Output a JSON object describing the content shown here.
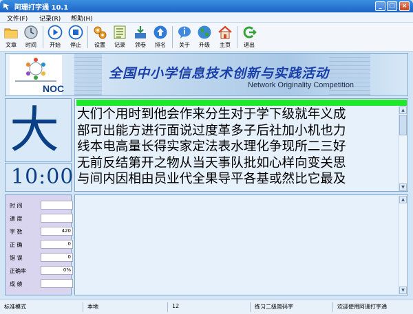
{
  "window": {
    "title": "阿珊打字通 10.1"
  },
  "menu": [
    "文件(F)",
    "记录(R)",
    "帮助(H)"
  ],
  "toolbar": [
    {
      "label": "文章",
      "icon": "folder-icon",
      "color": "#e9a524"
    },
    {
      "label": "时间",
      "icon": "clock-icon",
      "color": "#7a8a9c"
    },
    {
      "label": "开始",
      "icon": "play-icon",
      "color": "#1f68c9"
    },
    {
      "label": "停止",
      "icon": "stop-icon",
      "color": "#1f68c9"
    },
    {
      "label": "设置",
      "icon": "gears-icon",
      "color": "#d88a1f"
    },
    {
      "label": "记录",
      "icon": "records-list-icon",
      "color": "#6f8f2a"
    },
    {
      "label": "领卷",
      "icon": "download-icon",
      "color": "#2c8a4a"
    },
    {
      "label": "排名",
      "icon": "ranking-up-icon",
      "color": "#1f68c9"
    },
    {
      "label": "关于",
      "icon": "info-bubble-icon",
      "color": "#2f7bd9"
    },
    {
      "label": "升级",
      "icon": "globe-icon",
      "color": "#2c9a3a"
    },
    {
      "label": "主页",
      "icon": "home-icon",
      "color": "#d9452a"
    },
    {
      "label": "退出",
      "icon": "exit-icon",
      "color": "#36a23a"
    }
  ],
  "banner": {
    "logo": "NOC",
    "title": "全国中小学信息技术创新与实践活动",
    "subtitle": "Network Originality Competition"
  },
  "current_char": "大",
  "timer": "10:00",
  "text_lines": [
    "大们个用时到他会作来分生对于学下级就年义成",
    "部可出能方进行面说过度革多子后社加小机也力",
    "线本电高量长得实家定法表水理化争现所二三好",
    "无前反结第开之物从当天事队批如心样向变关思",
    "与间内因相由员业代全果导平各基或然比它最及"
  ],
  "stats": [
    {
      "key": "时 间",
      "value": ""
    },
    {
      "key": "速 度",
      "value": ""
    },
    {
      "key": "字 数",
      "value": "420"
    },
    {
      "key": "正 确",
      "value": "0"
    },
    {
      "key": "错 误",
      "value": "0"
    },
    {
      "key": "正确率",
      "value": "0%"
    },
    {
      "key": "成 绩",
      "value": ""
    }
  ],
  "status": {
    "mode": "标准模式",
    "source": "本地",
    "count": "12",
    "lesson": "练习二级简码字",
    "welcome": "欢迎使用阿珊打字通"
  }
}
